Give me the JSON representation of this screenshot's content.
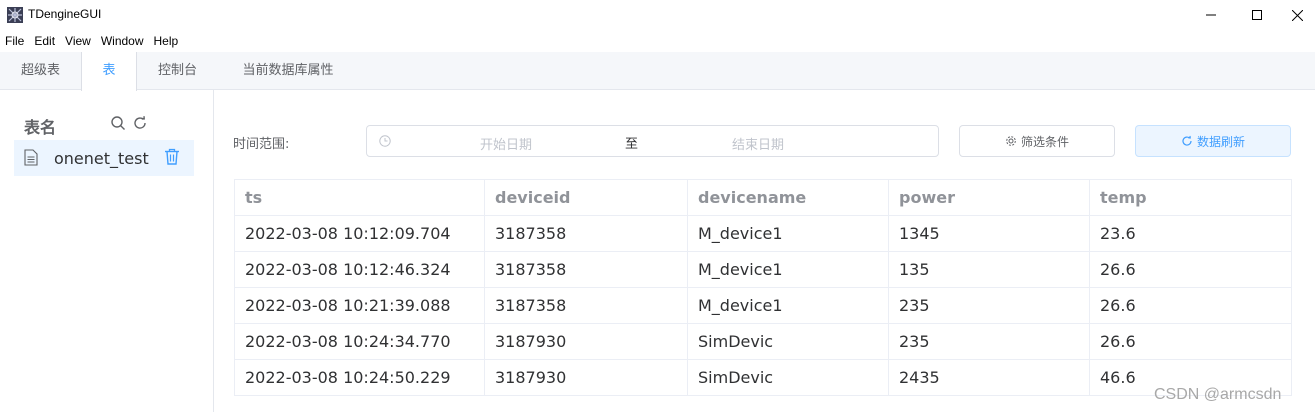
{
  "window": {
    "title": "TDengineGUI",
    "logo_icon": "tdengine-logo-icon",
    "controls": [
      "minimize-icon",
      "maximize-icon",
      "close-icon"
    ]
  },
  "menu": [
    "File",
    "Edit",
    "View",
    "Window",
    "Help"
  ],
  "tabs": [
    {
      "label": "超级表",
      "active": false
    },
    {
      "label": "表",
      "active": true
    },
    {
      "label": "控制台",
      "active": false
    },
    {
      "label": "当前数据库属性",
      "active": false
    }
  ],
  "sidebar": {
    "title": "表名",
    "search_icon": "search-icon",
    "refresh_icon": "refresh-icon",
    "items": [
      {
        "label": "onenet_test",
        "icon": "file-icon",
        "action_icon": "trash-icon",
        "selected": true
      }
    ]
  },
  "filter": {
    "label": "时间范围:",
    "start_placeholder": "开始日期",
    "separator": "至",
    "end_placeholder": "结束日期",
    "filter_button": "筛选条件",
    "refresh_button": "数据刷新"
  },
  "table": {
    "columns": [
      "ts",
      "deviceid",
      "devicename",
      "power",
      "temp"
    ],
    "rows": [
      [
        "2022-03-08 10:12:09.704",
        "3187358",
        "M_device1",
        "1345",
        "23.6"
      ],
      [
        "2022-03-08 10:12:46.324",
        "3187358",
        "M_device1",
        "135",
        "26.6"
      ],
      [
        "2022-03-08 10:21:39.088",
        "3187358",
        "M_device1",
        "235",
        "26.6"
      ],
      [
        "2022-03-08 10:24:34.770",
        "3187930",
        "SimDevic",
        "235",
        "26.6"
      ],
      [
        "2022-03-08 10:24:50.229",
        "3187930",
        "SimDevic",
        "2435",
        "46.6"
      ]
    ]
  },
  "watermark": "CSDN @armcsdn",
  "colors": {
    "accent": "#409eff",
    "accent_bg": "#ecf5ff",
    "border": "#dcdfe6",
    "text": "#303133",
    "muted": "#909399"
  }
}
